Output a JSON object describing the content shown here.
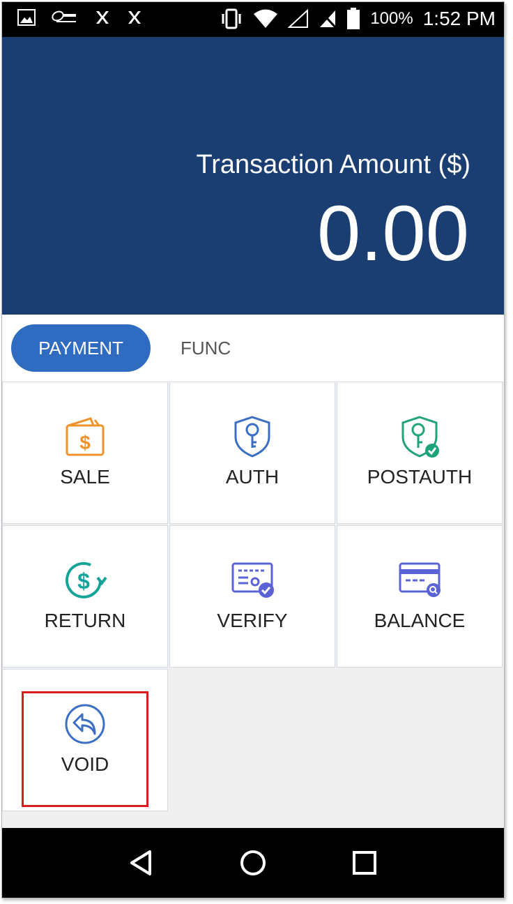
{
  "status_bar": {
    "left_icons": [
      "image-icon",
      "brand-logo-icon",
      "x-app-icon",
      "x-app-icon-2"
    ],
    "right_icons": [
      "vibrate-icon",
      "wifi-icon",
      "signal-icon",
      "no-sim-icon",
      "battery-icon"
    ],
    "battery_text": "100%",
    "time": "1:52 PM"
  },
  "header": {
    "amount_label": "Transaction Amount ($)",
    "amount_value": "0.00",
    "background": "#1a3e72"
  },
  "tabs": [
    {
      "label": "PAYMENT",
      "active": true
    },
    {
      "label": "FUNC",
      "active": false
    }
  ],
  "actions": [
    {
      "label": "SALE",
      "icon": "wallet-dollar-icon",
      "color": "#f0922a"
    },
    {
      "label": "AUTH",
      "icon": "shield-key-icon",
      "color": "#3b6fc4"
    },
    {
      "label": "POSTAUTH",
      "icon": "shield-key-check-icon",
      "color": "#1fa37a"
    },
    {
      "label": "RETURN",
      "icon": "dollar-refresh-icon",
      "color": "#15a39a"
    },
    {
      "label": "VERIFY",
      "icon": "card-check-icon",
      "color": "#5b63d6"
    },
    {
      "label": "BALANCE",
      "icon": "card-search-icon",
      "color": "#5b63d6"
    },
    {
      "label": "VOID",
      "icon": "undo-circle-icon",
      "color": "#3b6fc4"
    }
  ],
  "nav_bar": {
    "icons": [
      "back-icon",
      "home-icon",
      "recents-icon"
    ]
  }
}
